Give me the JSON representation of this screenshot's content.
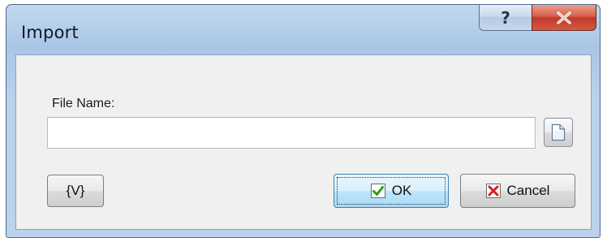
{
  "window": {
    "title": "Import",
    "help_label": "?"
  },
  "form": {
    "file_name_label": "File Name:",
    "file_name_value": "",
    "file_name_placeholder": ""
  },
  "buttons": {
    "variable_label": "{V}",
    "ok_label": "OK",
    "cancel_label": "Cancel"
  },
  "colors": {
    "ok_check": "#2a9a1f",
    "cancel_x": "#d21f1f",
    "close_button": "#c0392b"
  },
  "icons": {
    "help": "help-icon",
    "close": "close-icon",
    "browse": "document-icon",
    "ok": "checkmark-icon",
    "cancel": "x-icon"
  }
}
